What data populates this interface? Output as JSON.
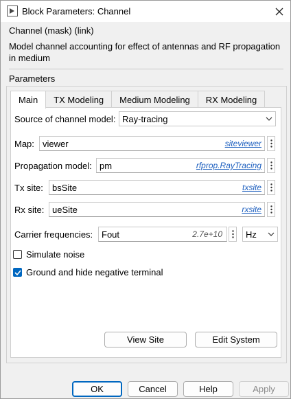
{
  "window": {
    "title": "Block Parameters: Channel"
  },
  "mask": {
    "title": "Channel (mask) (link)",
    "description": "Model channel accounting for effect of antennas and RF propagation in medium"
  },
  "parameters_label": "Parameters",
  "tabs": [
    {
      "label": "Main",
      "active": true
    },
    {
      "label": "TX Modeling",
      "active": false
    },
    {
      "label": "Medium Modeling",
      "active": false
    },
    {
      "label": "RX Modeling",
      "active": false
    }
  ],
  "main": {
    "source": {
      "label": "Source of channel model:",
      "value": "Ray-tracing"
    },
    "map": {
      "label": "Map:",
      "value": "viewer",
      "link": "siteviewer"
    },
    "propagation": {
      "label": "Propagation model:",
      "value": "pm",
      "link": "rfprop.RayTracing"
    },
    "tx": {
      "label": "Tx site:",
      "value": "bsSite",
      "link": "txsite"
    },
    "rx": {
      "label": "Rx site:",
      "value": "ueSite",
      "link": "rxsite"
    },
    "carrier": {
      "label": "Carrier frequencies:",
      "value": "Fout",
      "evaluated": "2.7e+10",
      "unit": "Hz"
    },
    "simulate_noise": {
      "label": "Simulate noise",
      "checked": false
    },
    "ground": {
      "label": "Ground and hide negative terminal",
      "checked": true
    },
    "view_site_label": "View Site",
    "edit_system_label": "Edit System"
  },
  "buttons": {
    "ok": "OK",
    "cancel": "Cancel",
    "help": "Help",
    "apply": "Apply"
  },
  "colors": {
    "accent": "#0067c0",
    "link": "#1d5fbf"
  }
}
